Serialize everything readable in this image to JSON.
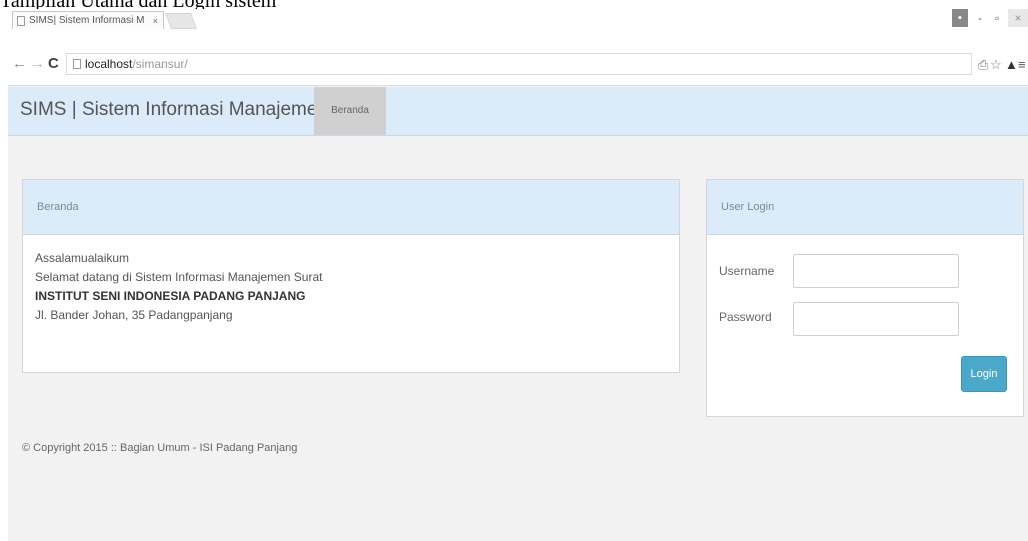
{
  "caption": "Tampilan Utama dan Login sistem",
  "browser": {
    "tab_title": "SIMS| Sistem Informasi M",
    "tab_close": "×",
    "url_host": "localhost",
    "url_path": "/simansur/",
    "window_controls": {
      "minimize_icon": "▪",
      "dash": "-",
      "maximize": "▫",
      "close": "×"
    },
    "nav": {
      "back": "←",
      "forward": "→",
      "reload": "C"
    },
    "toolbar_icons": {
      "ext1": "⎙",
      "star": "☆",
      "ext2": "▲",
      "menu": "≡"
    }
  },
  "navbar": {
    "brand": "SIMS | Sistem Informasi Manajemen Surat",
    "link_beranda": "Beranda"
  },
  "beranda_panel": {
    "heading": "Beranda",
    "line1": "Assalamualaikum",
    "line2": "Selamat datang di Sistem Informasi Manajemen Surat",
    "line3": "INSTITUT SENI INDONESIA PADANG PANJANG",
    "line4": "Jl. Bander Johan, 35 Padangpanjang"
  },
  "login_panel": {
    "heading": "User Login",
    "username_label": "Username",
    "password_label": "Password",
    "username_value": "",
    "password_value": "",
    "button": "Login"
  },
  "footer": "© Copyright 2015 :: Bagian Umum - ISI Padang Panjang"
}
